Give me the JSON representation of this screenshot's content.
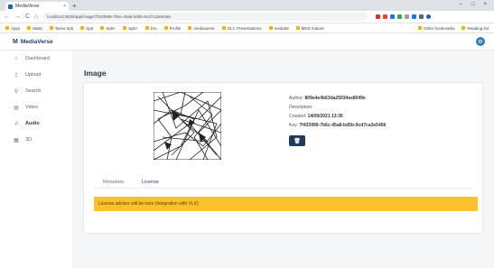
{
  "browser": {
    "tab_title": "MediaVerse",
    "tab_close": "×",
    "new_tab": "+",
    "window_controls": [
      "–",
      "□",
      "×"
    ],
    "url": "localhost:3000/app/image/7f433999-7b6c-45a8-bd5b-9cd7ca3e5456",
    "nav": [
      "←",
      "→",
      "C",
      "⌂"
    ],
    "bookmarks": [
      "Apps",
      "Mails",
      "Tarea Sp5",
      "Sp5",
      "Sp5+",
      "Sp5+",
      "Drv",
      "Profile",
      "mediaverse",
      "GLC Presentations",
      "mediaM",
      "MDS mature"
    ],
    "bookmarks_right": [
      "Other bookmarks",
      "Reading list"
    ]
  },
  "app": {
    "logo_mark": "M",
    "logo_text": "MediaVerse",
    "user_initial": "⚙"
  },
  "sidebar": {
    "items": [
      {
        "icon": "⌂",
        "label": "Dashboard"
      },
      {
        "icon": "⇪",
        "label": "Upload"
      },
      {
        "icon": "⚲",
        "label": "Search"
      },
      {
        "icon": "▤",
        "label": "Video"
      },
      {
        "icon": "♫",
        "label": "Audio"
      },
      {
        "icon": "▦",
        "label": "3D"
      }
    ]
  },
  "page": {
    "title": "Image",
    "author_label": "Author:",
    "author": "809e4e4b63da25034ee8049e",
    "description_label": "Description:",
    "description": "",
    "created_label": "Created:",
    "created": "14/09/2021 13:36",
    "key_label": "Key:",
    "key": "7f433999-7b6c-45a8-bd5b-9cd7ca3e5456",
    "delete_icon": "🗑",
    "tabs": [
      "Metadata",
      "License"
    ],
    "active_tab": "License",
    "alert": "License advisor will be here (integration with VLX)"
  }
}
